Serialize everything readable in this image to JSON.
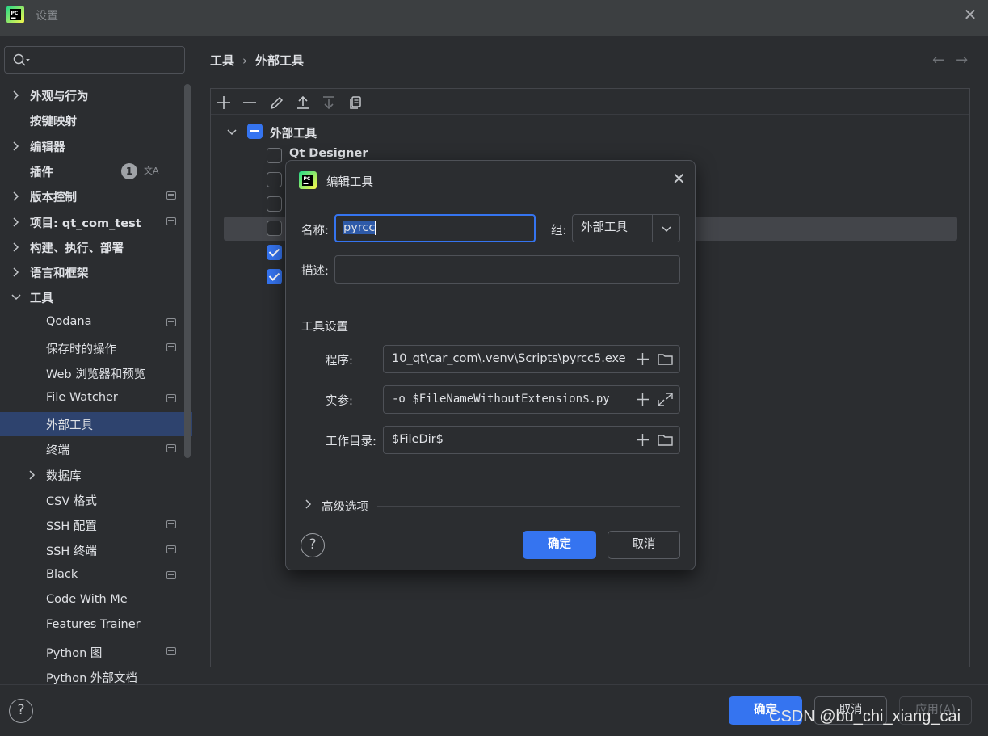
{
  "window": {
    "title": "设置"
  },
  "sidebar": {
    "search_placeholder": "",
    "items": [
      {
        "label": "外观与行为",
        "bold": true,
        "expandable": true,
        "indent": 0,
        "expanded": false
      },
      {
        "label": "按键映射",
        "bold": true,
        "expandable": false,
        "indent": 0
      },
      {
        "label": "编辑器",
        "bold": true,
        "expandable": true,
        "indent": 0,
        "expanded": false
      },
      {
        "label": "插件",
        "bold": true,
        "expandable": false,
        "indent": 0,
        "badge": "1",
        "translate_icon": "translate-icon"
      },
      {
        "label": "版本控制",
        "bold": true,
        "expandable": true,
        "indent": 0,
        "expanded": false,
        "settings_icon": true
      },
      {
        "label": "项目: qt_com_test",
        "bold": true,
        "expandable": true,
        "indent": 0,
        "expanded": false,
        "settings_icon": true
      },
      {
        "label": "构建、执行、部署",
        "bold": true,
        "expandable": true,
        "indent": 0,
        "expanded": false
      },
      {
        "label": "语言和框架",
        "bold": true,
        "expandable": true,
        "indent": 0,
        "expanded": false
      },
      {
        "label": "工具",
        "bold": true,
        "expandable": true,
        "indent": 0,
        "expanded": true
      },
      {
        "label": "Qodana",
        "bold": false,
        "expandable": false,
        "indent": 1,
        "settings_icon": true
      },
      {
        "label": "保存时的操作",
        "bold": false,
        "expandable": false,
        "indent": 1,
        "settings_icon": true
      },
      {
        "label": "Web 浏览器和预览",
        "bold": false,
        "expandable": false,
        "indent": 1
      },
      {
        "label": "File Watcher",
        "bold": false,
        "expandable": false,
        "indent": 1,
        "settings_icon": true
      },
      {
        "label": "外部工具",
        "bold": false,
        "expandable": false,
        "indent": 1,
        "selected": true
      },
      {
        "label": "终端",
        "bold": false,
        "expandable": false,
        "indent": 1,
        "settings_icon": true
      },
      {
        "label": "数据库",
        "bold": false,
        "expandable": true,
        "indent": 1,
        "expanded": false
      },
      {
        "label": "CSV 格式",
        "bold": false,
        "expandable": false,
        "indent": 1
      },
      {
        "label": "SSH 配置",
        "bold": false,
        "expandable": false,
        "indent": 1,
        "settings_icon": true
      },
      {
        "label": "SSH 终端",
        "bold": false,
        "expandable": false,
        "indent": 1,
        "settings_icon": true
      },
      {
        "label": "Black",
        "bold": false,
        "expandable": false,
        "indent": 1,
        "settings_icon": true
      },
      {
        "label": "Code With Me",
        "bold": false,
        "expandable": false,
        "indent": 1
      },
      {
        "label": "Features Trainer",
        "bold": false,
        "expandable": false,
        "indent": 1
      },
      {
        "label": "Python 图",
        "bold": false,
        "expandable": false,
        "indent": 1,
        "settings_icon": true
      },
      {
        "label": "Python 外部文档",
        "bold": false,
        "expandable": false,
        "indent": 1
      }
    ]
  },
  "content": {
    "breadcrumb": [
      "工具",
      "外部工具"
    ],
    "breadcrumb_sep": "›",
    "toolbar_icons": [
      "add-icon",
      "remove-icon",
      "edit-icon",
      "move-up-icon",
      "move-down-icon",
      "copy-icon"
    ],
    "tree": {
      "group_label": "外部工具",
      "group_state": "partial",
      "rows": [
        {
          "label": "Qt Designer",
          "checked": false
        },
        {
          "label": "",
          "checked": false
        },
        {
          "label": "",
          "checked": false
        },
        {
          "label": "",
          "checked": false,
          "selected": true
        },
        {
          "label": "",
          "checked": true
        },
        {
          "label": "",
          "checked": true
        }
      ]
    }
  },
  "dialog": {
    "title": "编辑工具",
    "name_label": "名称:",
    "name_value": "pyrcc",
    "group_label": "组:",
    "group_value": "外部工具",
    "desc_label": "描述:",
    "desc_value": "",
    "tool_settings_title": "工具设置",
    "program_label": "程序:",
    "program_value": "10_qt\\car_com\\.venv\\Scripts\\pyrcc5.exe",
    "args_label": "实参:",
    "args_value": "-o $FileNameWithoutExtension$.py",
    "workdir_label": "工作目录:",
    "workdir_value": "$FileDir$",
    "advanced_title": "高级选项",
    "help_symbol": "?",
    "ok_label": "确定",
    "cancel_label": "取消"
  },
  "footer": {
    "help_symbol": "?",
    "ok_label": "确定",
    "cancel_label": "取消",
    "apply_label": "应用(A)"
  },
  "watermark": "CSDN @bu_chi_xiang_cai",
  "colors": {
    "accent": "#3574f0",
    "background": "#2b2d30",
    "titlebar": "#3c3f41",
    "selection": "#2e436e"
  }
}
